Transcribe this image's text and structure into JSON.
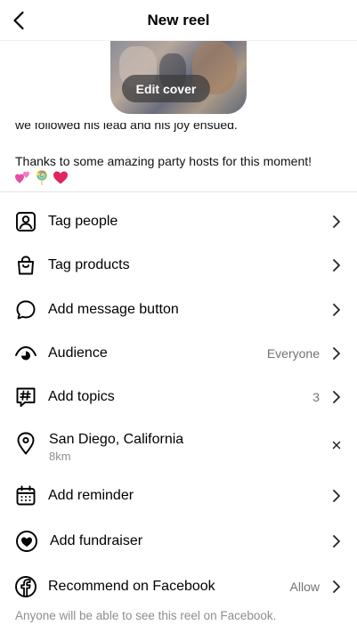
{
  "header": {
    "title": "New reel"
  },
  "cover": {
    "edit_label": "Edit cover"
  },
  "caption": {
    "cut_line": "we followed his lead and his joy ensued.",
    "text": "Thanks to some amazing party hosts for this moment!",
    "emojis": [
      "two-hearts-emoji",
      "lollipop-emoji",
      "red-heart-emoji"
    ]
  },
  "options": {
    "tag_people": {
      "label": "Tag people"
    },
    "tag_products": {
      "label": "Tag products"
    },
    "message_button": {
      "label": "Add message button"
    },
    "audience": {
      "label": "Audience",
      "value": "Everyone"
    },
    "topics": {
      "label": "Add topics",
      "value": "3"
    },
    "location": {
      "title": "San Diego, California",
      "distance": "8km"
    },
    "reminder": {
      "label": "Add reminder"
    },
    "fundraiser": {
      "label": "Add fundraiser"
    },
    "facebook": {
      "label": "Recommend on Facebook",
      "value": "Allow"
    }
  },
  "footer": {
    "note": "Anyone will be able to see this reel on Facebook."
  },
  "colors": {
    "text": "#000000",
    "secondary": "#737373",
    "divider": "#e6e6e6",
    "emoji_heart": "#e0245e"
  }
}
